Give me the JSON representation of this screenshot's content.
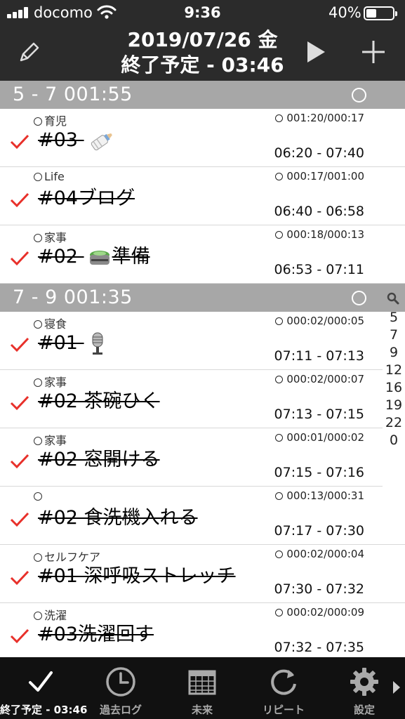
{
  "status": {
    "carrier": "docomo",
    "time": "9:36",
    "battery": "40%"
  },
  "nav": {
    "date": "2019/07/26 金",
    "subtitle": "終了予定 - 03:46"
  },
  "sections": [
    {
      "label": "5 - 7   001:55",
      "rows": [
        {
          "category": "育児",
          "duration": "001:20/000:17",
          "title": "#03",
          "emoji": "bottle",
          "range": "06:20 - 07:40"
        },
        {
          "category": "Life",
          "duration": "000:17/001:00",
          "title": "#04ブログ",
          "emoji": "",
          "range": "06:40 - 06:58"
        },
        {
          "category": "家事",
          "duration": "000:18/000:13",
          "title": "#02",
          "emoji": "rice",
          "title_suffix": "準備",
          "range": "06:53 - 07:11"
        }
      ]
    },
    {
      "label": "7 - 9   001:35",
      "rows": [
        {
          "category": "寝食",
          "duration": "000:02/000:05",
          "title": "#01",
          "emoji": "mic",
          "range": "07:11 - 07:13"
        },
        {
          "category": "家事",
          "duration": "000:02/000:07",
          "title": "#02 茶碗ひく",
          "emoji": "",
          "range": "07:13 - 07:15"
        },
        {
          "category": "家事",
          "duration": "000:01/000:02",
          "title": "#02 窓開ける",
          "emoji": "",
          "range": "07:15 - 07:16"
        },
        {
          "category": "",
          "duration": "000:13/000:31",
          "title": "#02 食洗機入れる",
          "emoji": "",
          "range": "07:17 - 07:30"
        },
        {
          "category": "セルフケア",
          "duration": "000:02/000:04",
          "title": "#01 深呼吸ストレッチ",
          "emoji": "",
          "range": "07:30 - 07:32"
        },
        {
          "category": "洗濯",
          "duration": "000:02/000:09",
          "title": "#03洗濯回す",
          "emoji": "",
          "range": "07:32 - 07:35"
        }
      ]
    }
  ],
  "index": [
    "5",
    "7",
    "9",
    "12",
    "16",
    "19",
    "22",
    "0"
  ],
  "tabs": [
    {
      "label": "終了予定 - 03:46",
      "icon": "check-icon"
    },
    {
      "label": "過去ログ",
      "icon": "clock-icon"
    },
    {
      "label": "未来",
      "icon": "calendar-icon"
    },
    {
      "label": "リピート",
      "icon": "repeat-icon"
    },
    {
      "label": "設定",
      "icon": "gear-icon"
    }
  ],
  "colors": {
    "check": "#e8302a",
    "section": "#a7a7a7",
    "bar": "#2b2b2b",
    "tabbar": "#111111"
  }
}
